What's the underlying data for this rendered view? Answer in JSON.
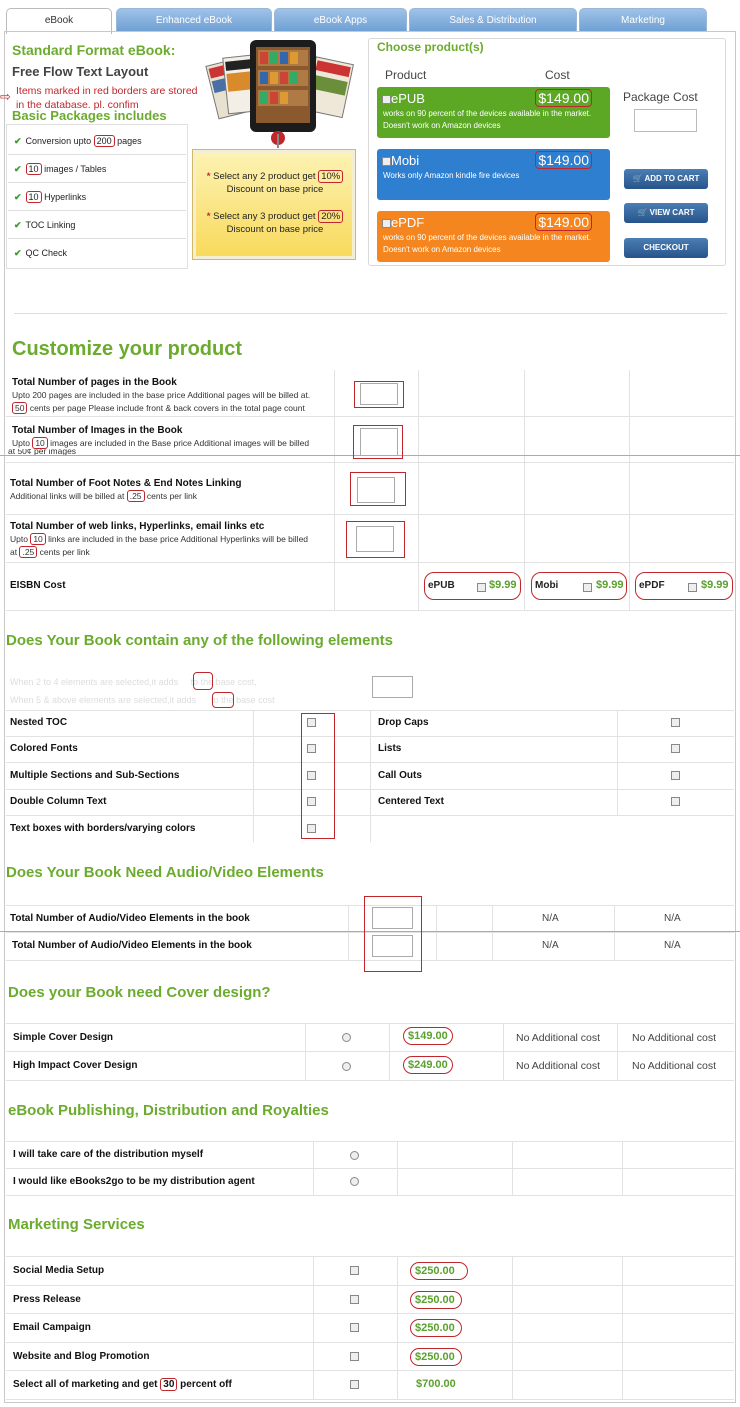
{
  "tabs": [
    "eBook",
    "Enhanced eBook",
    "eBook Apps",
    "Sales & Distribution",
    "Marketing"
  ],
  "header": {
    "title": "Standard Format eBook:",
    "subtitle": "Free Flow Text Layout",
    "note_arrow": "⇨",
    "note": "Items marked in red borders are stored in the database. pl. confim",
    "packages_title": "Basic Packages includes"
  },
  "features": [
    {
      "pre": "Conversion upto ",
      "num": "200",
      "post": " pages"
    },
    {
      "pre": "",
      "num": "10",
      "post": " images / Tables"
    },
    {
      "pre": "",
      "num": "10",
      "post": " Hyperlinks"
    },
    {
      "pre": "TOC Linking",
      "num": "",
      "post": ""
    },
    {
      "pre": "QC Check",
      "num": "",
      "post": ""
    }
  ],
  "discount": {
    "line1_pre": "Select any 2 product get ",
    "line1_num": "10%",
    "line1_post": "Discount on base price",
    "line2_pre": "Select any 3 product get ",
    "line2_num": "20%",
    "line2_post": "Discount on base price"
  },
  "products": {
    "title": "Choose product(s)",
    "col_product": "Product",
    "col_cost": "Cost",
    "package_cost": "Package Cost",
    "items": [
      {
        "name": "ePUB",
        "price": "$149.00",
        "desc": "works on 90 percent of the devices available in the market. Doesn't work on Amazon devices",
        "color": "#5ca824"
      },
      {
        "name": "Mobi",
        "price": "$149.00",
        "desc": "Works only Amazon kindle fire devices",
        "color": "#2f7fd0"
      },
      {
        "name": "ePDF",
        "price": "$149.00",
        "desc": "works on 90 percent of the devices available in the market. Doesn't work on Amazon devices",
        "color": "#f5861f"
      }
    ],
    "buttons": [
      "ADD TO CART",
      "VIEW CART",
      "CHECKOUT"
    ]
  },
  "customize": {
    "title": "Customize your product",
    "pages_label": "Total Number of pages in the Book",
    "pages_desc_pre": "Upto 200 pages are included in the base price Additional pages will be billed at.",
    "pages_num": "50",
    "pages_desc_post": " cents per page Please include front & back covers in the total page count",
    "images_label": "Total Number of Images in the Book",
    "images_pre": "Upto ",
    "images_num": "10",
    "images_post": " images are included in the Base price Additional images will be billed",
    "images_cut": "at 50¢ per images",
    "foot_label": "Total Number of Foot Notes & End Notes Linking",
    "foot_pre": "Additional links will be billed at ",
    "foot_num": ".25",
    "foot_post": " cents per link",
    "web_label": "Total Number of web links, Hyperlinks, email links etc",
    "web_pre": "Upto ",
    "web_num": "10",
    "web_post": " links are included in the base price Additional Hyperlinks will be billed",
    "web_pre2": "at ",
    "web_num2": ".25",
    "web_post2": " cents per link",
    "eisbn_label": "EISBN Cost",
    "eisbn": [
      {
        "name": "ePUB",
        "price": "$9.99"
      },
      {
        "name": "Mobi",
        "price": "$9.99"
      },
      {
        "name": "ePDF",
        "price": "$9.99"
      }
    ]
  },
  "elements": {
    "title": "Does Your Book contain any of the following elements",
    "faint1": "When 2 to 4 elements are selected,it adds     to the base cost,",
    "faint2": "When 5 & above elements are selected,it adds      to the base cost",
    "left": [
      "Nested TOC",
      "Colored Fonts",
      "Multiple Sections and Sub-Sections",
      "Double Column Text",
      "Text boxes with borders/varying colors"
    ],
    "right": [
      "Drop Caps",
      "Lists",
      "Call Outs",
      "Centered Text"
    ]
  },
  "av": {
    "title": "Does Your Book Need Audio/Video Elements",
    "rows": [
      "Total Number of Audio/Video Elements in the book",
      "Total Number of Audio/Video Elements in the book"
    ],
    "na": "N/A"
  },
  "cover": {
    "title": "Does your Book need Cover design?",
    "rows": [
      {
        "label": "Simple Cover Design",
        "price": "$149.00"
      },
      {
        "label": "High Impact Cover Design",
        "price": "$249.00"
      }
    ],
    "no_cost": "No Additional cost"
  },
  "publishing": {
    "title": "eBook Publishing, Distribution and Royalties",
    "rows": [
      "I will take care of the distribution myself",
      "I would like eBooks2go to be my distribution agent"
    ]
  },
  "marketing": {
    "title": "Marketing Services",
    "rows": [
      {
        "label": "Social Media Setup",
        "price": "$250.00"
      },
      {
        "label": "Press Release",
        "price": "$250.00"
      },
      {
        "label": "Email Campaign",
        "price": "$250.00"
      },
      {
        "label": "Website and Blog Promotion",
        "price": "$250.00"
      }
    ],
    "all_pre": "Select all of marketing and get ",
    "all_num": "30",
    "all_post": " percent off",
    "all_price": "$700.00"
  }
}
